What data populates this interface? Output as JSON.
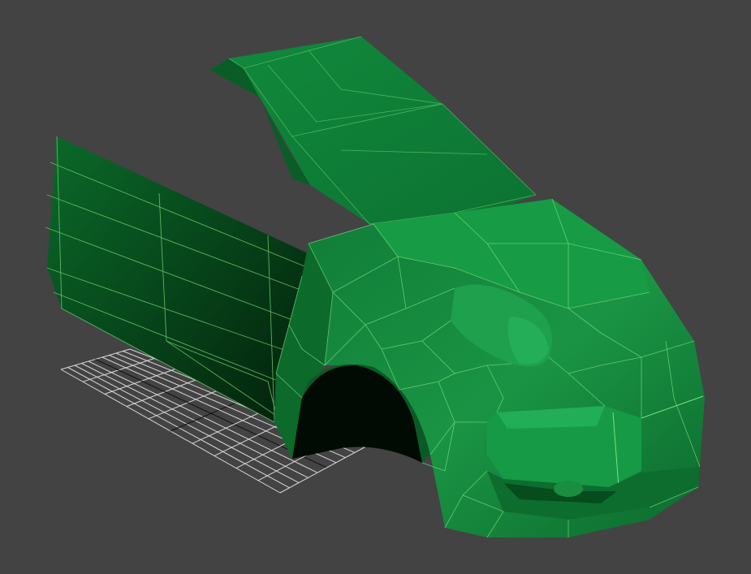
{
  "viewport": {
    "background": "#434343",
    "grid_color": "#d8d8d8",
    "grid_axis_color": "#111111",
    "model_wire_color": "#7fe07f",
    "model_face_light": "#1e9a4a",
    "model_face_mid": "#138038",
    "model_face_dark": "#0a5a24",
    "model_shadow": "#052e12"
  },
  "model": {
    "parts": [
      "hood-panel",
      "door-panel",
      "front-fender",
      "front-bumper",
      "headlight",
      "grille",
      "fog-light",
      "wheel-arch"
    ]
  },
  "grid": {
    "divisions": 10
  }
}
